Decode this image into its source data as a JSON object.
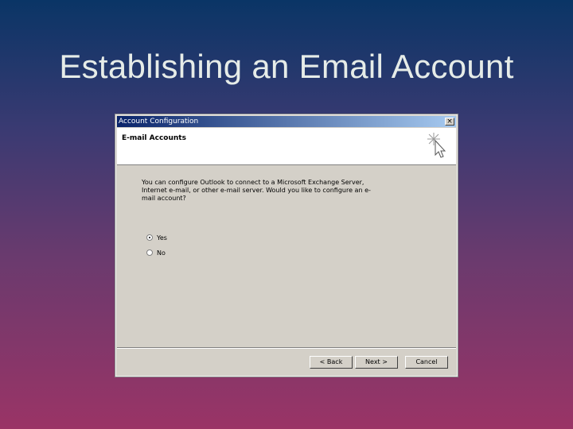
{
  "slide": {
    "title": "Establishing an Email Account"
  },
  "dialog": {
    "title": "Account Configuration",
    "close_label": "×",
    "header": "E-mail Accounts",
    "prompt": "You can configure Outlook to connect to a Microsoft Exchange Server, Internet e-mail, or other e-mail server. Would you like to configure an e-mail account?",
    "options": [
      {
        "label": "Yes",
        "selected": true
      },
      {
        "label": "No",
        "selected": false
      }
    ],
    "buttons": {
      "back": "< Back",
      "next": "Next >",
      "cancel": "Cancel"
    }
  },
  "colors": {
    "bg_top": "#0a3566",
    "bg_bottom": "#9a3466",
    "dialog_face": "#d4d0c8",
    "titlebar": "#0a246a"
  },
  "icons": {
    "header_icon": "sparkle-cursor-icon"
  }
}
